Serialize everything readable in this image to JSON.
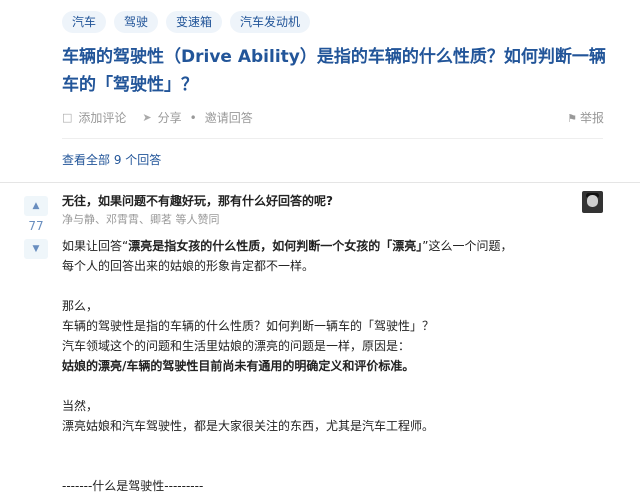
{
  "tags": [
    "汽车",
    "驾驶",
    "变速箱",
    "汽车发动机"
  ],
  "question": {
    "title": "车辆的驾驶性（Drive Ability）是指的车辆的什么性质？如何判断一辆车的「驾驶性」？"
  },
  "actions": {
    "comment": "添加评论",
    "share": "分享",
    "dot": "•",
    "invite": "邀请回答",
    "report": "举报"
  },
  "view_all": "查看全部 9 个回答",
  "answer": {
    "vote_count": "77",
    "author_line": "无往，如果问题不有趣好玩，那有什么好回答的呢?",
    "voters": "净与静、邓霄霄、卿茗 等人赞同",
    "lines": [
      {
        "pre": "如果让回答“",
        "bold": "漂亮是指女孩的什么性质，如何判断一个女孩的「漂亮」",
        "post": "”这么一个问题，"
      },
      {
        "pre": "每个人的回答出来的姑娘的形象肯定都不一样。",
        "bold": "",
        "post": ""
      },
      {
        "gap": true
      },
      {
        "pre": "那么，",
        "bold": "",
        "post": ""
      },
      {
        "pre": "车辆的驾驶性是指的车辆的什么性质？如何判断一辆车的「驾驶性」？",
        "bold": "",
        "post": ""
      },
      {
        "pre": "汽车领域这个的问题和生活里姑娘的漂亮的问题是一样，原因是：",
        "bold": "",
        "post": ""
      },
      {
        "pre": "",
        "bold": "姑娘的漂亮/车辆的驾驶性目前尚未有通用的明确定义和评价标准。",
        "post": ""
      },
      {
        "gap": true
      },
      {
        "pre": "当然，",
        "bold": "",
        "post": ""
      },
      {
        "pre": "漂亮姑娘和汽车驾驶性，都是大家很关注的东西，尤其是汽车工程师。",
        "bold": "",
        "post": ""
      },
      {
        "gap": true
      },
      {
        "gap": true
      },
      {
        "pre": "-------什么是驾驶性---------",
        "bold": "",
        "post": ""
      }
    ]
  },
  "icons": {
    "comment": "comment-icon",
    "share": "share-icon",
    "report": "flag-icon",
    "upvote": "triangle-up-icon",
    "downvote": "triangle-down-icon"
  },
  "colors": {
    "link": "#225599",
    "tag_bg": "#eef4fa",
    "vote": "#698ebf"
  }
}
